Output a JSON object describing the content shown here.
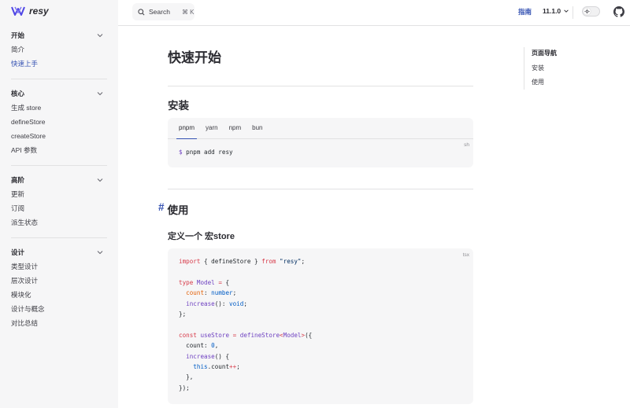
{
  "app": {
    "logo_text": "resy"
  },
  "sidebar": {
    "groups": [
      {
        "title": "开始",
        "items": [
          {
            "label": "简介"
          },
          {
            "label": "快速上手",
            "active": true
          }
        ]
      },
      {
        "title": "核心",
        "items": [
          {
            "label": "生成 store"
          },
          {
            "label": "defineStore"
          },
          {
            "label": "createStore"
          },
          {
            "label": "API 参数"
          }
        ]
      },
      {
        "title": "高阶",
        "items": [
          {
            "label": "更新"
          },
          {
            "label": "订阅"
          },
          {
            "label": "派生状态"
          }
        ]
      },
      {
        "title": "设计",
        "items": [
          {
            "label": "类型设计"
          },
          {
            "label": "层次设计"
          },
          {
            "label": "模块化"
          },
          {
            "label": "设计与概念"
          },
          {
            "label": "对比总结"
          }
        ]
      }
    ]
  },
  "topbar": {
    "search_label": "Search",
    "search_shortcut": "⌘ K",
    "nav_link": "指南",
    "version": "11.1.0"
  },
  "main": {
    "title": "快速开始",
    "install_heading": "安装",
    "install_tabs": [
      "pnpm",
      "yarn",
      "npm",
      "bun"
    ],
    "install_lang": "sh",
    "install_prompt": "$",
    "install_command": "pnpm add resy",
    "usage_hash": "#",
    "usage_heading": "使用",
    "define_heading": "定义一个 宏store",
    "code_lang": "tsx"
  },
  "outline": {
    "title": "页面导航",
    "items": [
      "安装",
      "使用"
    ]
  },
  "colors": {
    "accent": "#3451b2",
    "sidebar_bg": "#f6f6f7",
    "code_bg": "#f6f6f7"
  }
}
